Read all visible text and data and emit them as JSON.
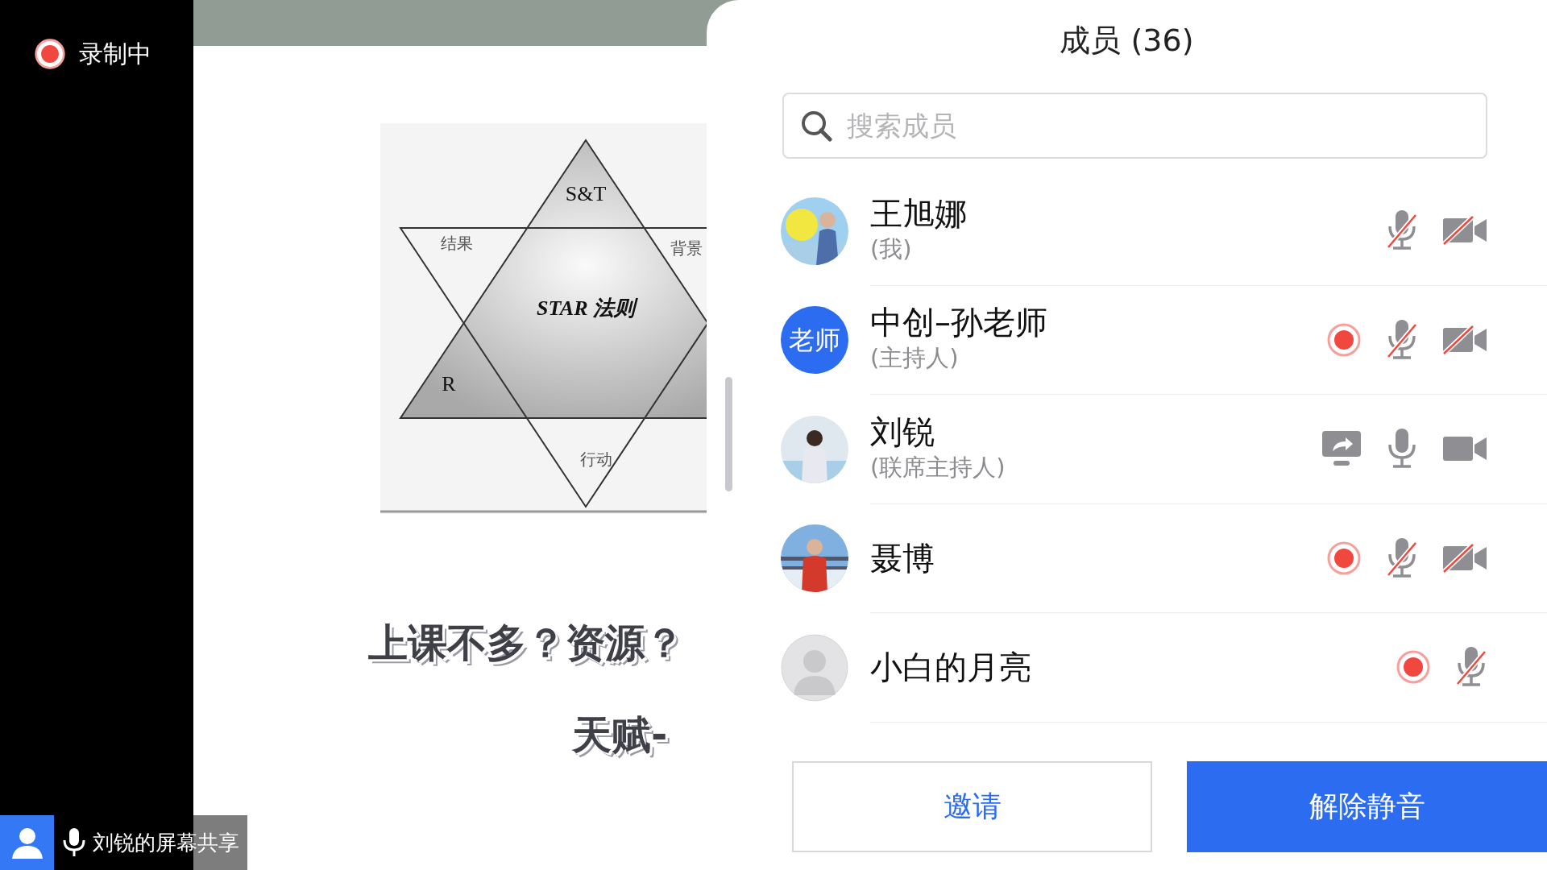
{
  "recording_indicator": {
    "label": "录制中"
  },
  "slide": {
    "diagram_labels": [
      {
        "text": "S&T"
      },
      {
        "text": "结果"
      },
      {
        "text": "背景"
      },
      {
        "text": "STAR 法则"
      },
      {
        "text": "R"
      },
      {
        "text": "行动"
      }
    ],
    "lines": [
      "上课不多？资源？",
      "天赋-"
    ]
  },
  "share_label": {
    "text": "刘锐的屏幕共享"
  },
  "members_panel": {
    "title": "成员 (36)",
    "search": {
      "placeholder": "搜索成员"
    },
    "members": [
      {
        "name": "王旭娜",
        "role": "(我)",
        "recording": false,
        "sharing": false,
        "mic_muted": true,
        "camera_muted": true
      },
      {
        "name": "中创–孙老师",
        "role": "(主持人)",
        "avatar": {
          "kind": "text",
          "text": "老师"
        },
        "recording": true,
        "sharing": false,
        "mic_muted": true,
        "camera_muted": true
      },
      {
        "name": "刘锐",
        "role": "(联席主持人)",
        "recording": false,
        "sharing": true,
        "mic_muted": false,
        "camera_muted": false
      },
      {
        "name": "聂博",
        "recording": true,
        "sharing": false,
        "mic_muted": true,
        "camera_muted": true
      },
      {
        "name": "小白的月亮",
        "avatar": {
          "kind": "default"
        },
        "recording": true,
        "sharing": false,
        "mic_muted": true
      }
    ],
    "buttons": [
      {
        "label": "邀请",
        "kind": "outline"
      },
      {
        "label": "解除静音",
        "kind": "primary"
      }
    ]
  }
}
